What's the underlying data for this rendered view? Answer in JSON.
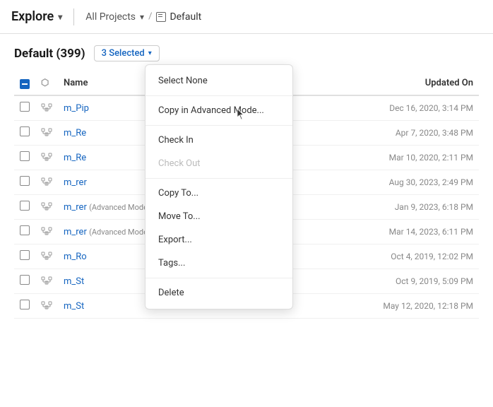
{
  "nav": {
    "explore_label": "Explore",
    "projects_label": "All Projects",
    "separator": "/",
    "default_label": "Default"
  },
  "section": {
    "title": "Default",
    "count": "(399)",
    "selected_label": "3 Selected"
  },
  "table": {
    "col_name": "Name",
    "col_updated": "Updated On",
    "rows": [
      {
        "name": "m_Pip",
        "date": "Dec 16, 2020, 3:14 PM"
      },
      {
        "name": "m_Re",
        "date": "Apr 7, 2020, 3:48 PM"
      },
      {
        "name": "m_Re",
        "date": "Mar 10, 2020, 2:11 PM"
      },
      {
        "name": "m_rer",
        "date": "Aug 30, 2023, 2:49 PM"
      },
      {
        "name": "m_rer",
        "date": "Jan 9, 2023, 6:18 PM",
        "suffix": "(Advanced Mode)"
      },
      {
        "name": "m_rer",
        "date": "Mar 14, 2023, 6:11 PM",
        "suffix": "(Advanced Mode)"
      },
      {
        "name": "m_Ro",
        "date": "Oct 4, 2019, 12:02 PM"
      },
      {
        "name": "m_St",
        "date": "Oct 9, 2019, 5:09 PM"
      },
      {
        "name": "m_St",
        "date": "May 12, 2020, 12:18 PM"
      }
    ]
  },
  "menu": {
    "items": [
      {
        "id": "select-none",
        "label": "Select None",
        "disabled": false
      },
      {
        "id": "copy-advanced",
        "label": "Copy in Advanced Mode...",
        "disabled": false
      },
      {
        "id": "check-in",
        "label": "Check In",
        "disabled": false
      },
      {
        "id": "check-out",
        "label": "Check Out",
        "disabled": true
      },
      {
        "id": "copy-to",
        "label": "Copy To...",
        "disabled": false
      },
      {
        "id": "move-to",
        "label": "Move To...",
        "disabled": false
      },
      {
        "id": "export",
        "label": "Export...",
        "disabled": false
      },
      {
        "id": "tags",
        "label": "Tags...",
        "disabled": false
      },
      {
        "id": "delete",
        "label": "Delete",
        "disabled": false
      }
    ]
  }
}
